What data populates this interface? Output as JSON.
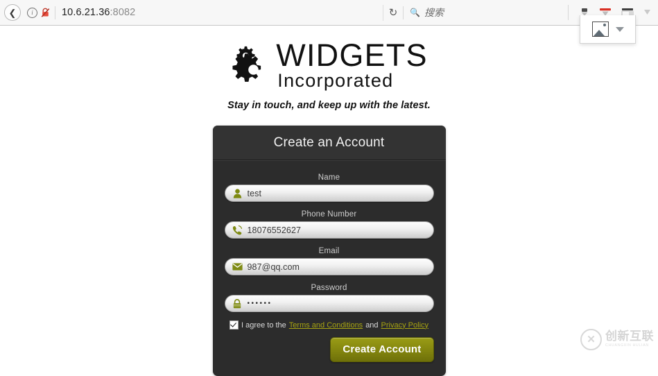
{
  "browser": {
    "back_icon": "back-arrow-icon",
    "info_icon": "info-icon",
    "insecure_icon": "broken-lock-icon",
    "url": "10.6.21.36",
    "url_port": ":8082",
    "reload_icon": "reload-icon",
    "search_icon": "search-icon",
    "search_placeholder": "搜索",
    "popup": {
      "image_icon": "image-icon",
      "caret_icon": "chevron-down-icon"
    }
  },
  "site": {
    "logo": {
      "gear_icon": "gears-icon",
      "name_top": "WIDGETS",
      "name_bottom": "Incorporated"
    },
    "tagline": "Stay in touch, and keep up with the latest."
  },
  "form": {
    "title": "Create an Account",
    "fields": [
      {
        "label": "Name",
        "icon": "person-icon",
        "value": "test",
        "masked": false
      },
      {
        "label": "Phone Number",
        "icon": "phone-icon",
        "value": "18076552627",
        "masked": false
      },
      {
        "label": "Email",
        "icon": "envelope-icon",
        "value": "987@qq.com",
        "masked": false
      },
      {
        "label": "Password",
        "icon": "lock-icon",
        "value": "••••••",
        "masked": true
      }
    ],
    "agreement": {
      "checked": true,
      "prefix": "I agree to the ",
      "terms_link": "Terms and Conditions",
      "conjunction": " and ",
      "privacy_link": "Privacy Policy"
    },
    "submit_label": "Create Account"
  },
  "watermark": {
    "mark": "✕",
    "cn": "创新互联",
    "pinyin": "CHUANGXIN HULIAN"
  },
  "colors": {
    "panel_bg": "#2c2c2c",
    "panel_header_bg": "#333333",
    "accent_olive": "#86880f",
    "link_olive": "#a8a411",
    "icon_olive": "#7e8a12"
  }
}
